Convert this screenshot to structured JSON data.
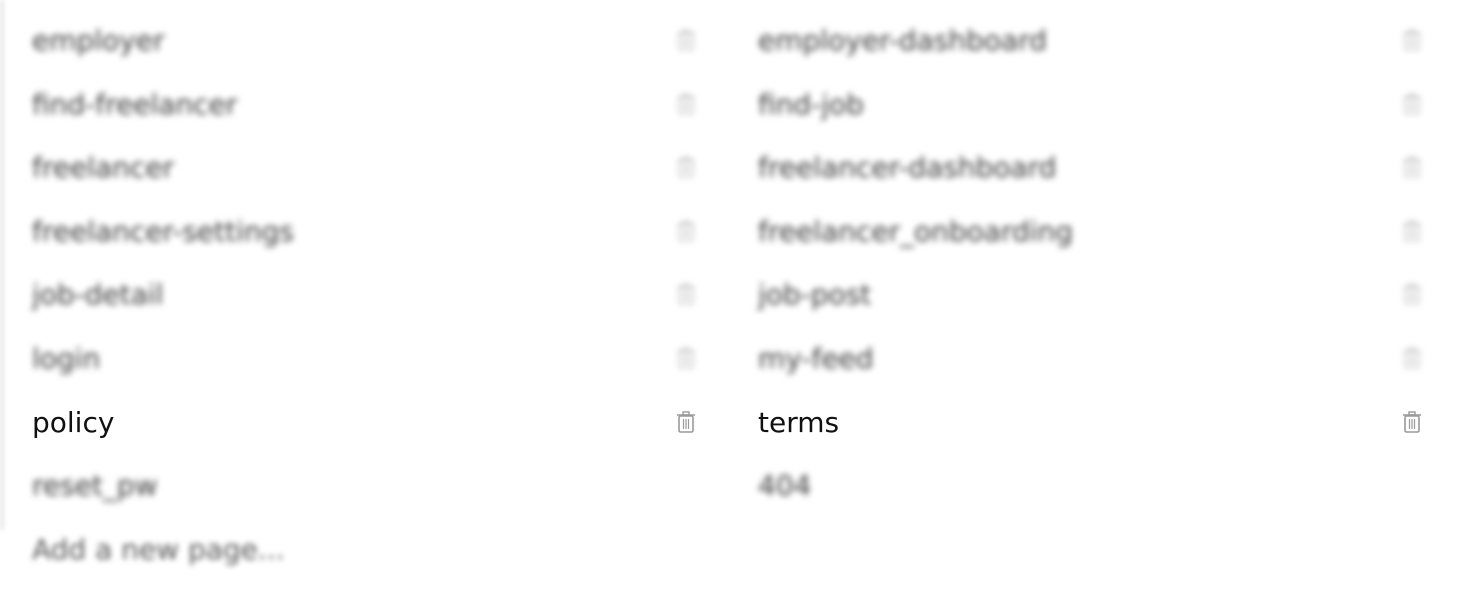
{
  "pages": [
    {
      "left": {
        "label": "employer",
        "deletable": true,
        "active": false
      },
      "right": {
        "label": "employer-dashboard",
        "deletable": true,
        "active": false
      }
    },
    {
      "left": {
        "label": "find-freelancer",
        "deletable": true,
        "active": false
      },
      "right": {
        "label": "find-job",
        "deletable": true,
        "active": false
      }
    },
    {
      "left": {
        "label": "freelancer",
        "deletable": true,
        "active": false
      },
      "right": {
        "label": "freelancer-dashboard",
        "deletable": true,
        "active": false
      }
    },
    {
      "left": {
        "label": "freelancer-settings",
        "deletable": true,
        "active": false
      },
      "right": {
        "label": "freelancer_onboarding",
        "deletable": true,
        "active": false
      }
    },
    {
      "left": {
        "label": "job-detail",
        "deletable": true,
        "active": false
      },
      "right": {
        "label": "job-post",
        "deletable": true,
        "active": false
      }
    },
    {
      "left": {
        "label": "login",
        "deletable": true,
        "active": false
      },
      "right": {
        "label": "my-feed",
        "deletable": true,
        "active": false
      }
    },
    {
      "left": {
        "label": "policy",
        "deletable": true,
        "active": true
      },
      "right": {
        "label": "terms",
        "deletable": true,
        "active": true
      }
    },
    {
      "left": {
        "label": "reset_pw",
        "deletable": false,
        "active": false
      },
      "right": {
        "label": "404",
        "deletable": false,
        "active": false
      }
    }
  ],
  "add_page_label": "Add a new page...",
  "icons": {
    "delete": "trash-icon"
  },
  "colors": {
    "active_text": "#111111",
    "muted_text": "#444444",
    "icon": "#9a9a9a"
  }
}
